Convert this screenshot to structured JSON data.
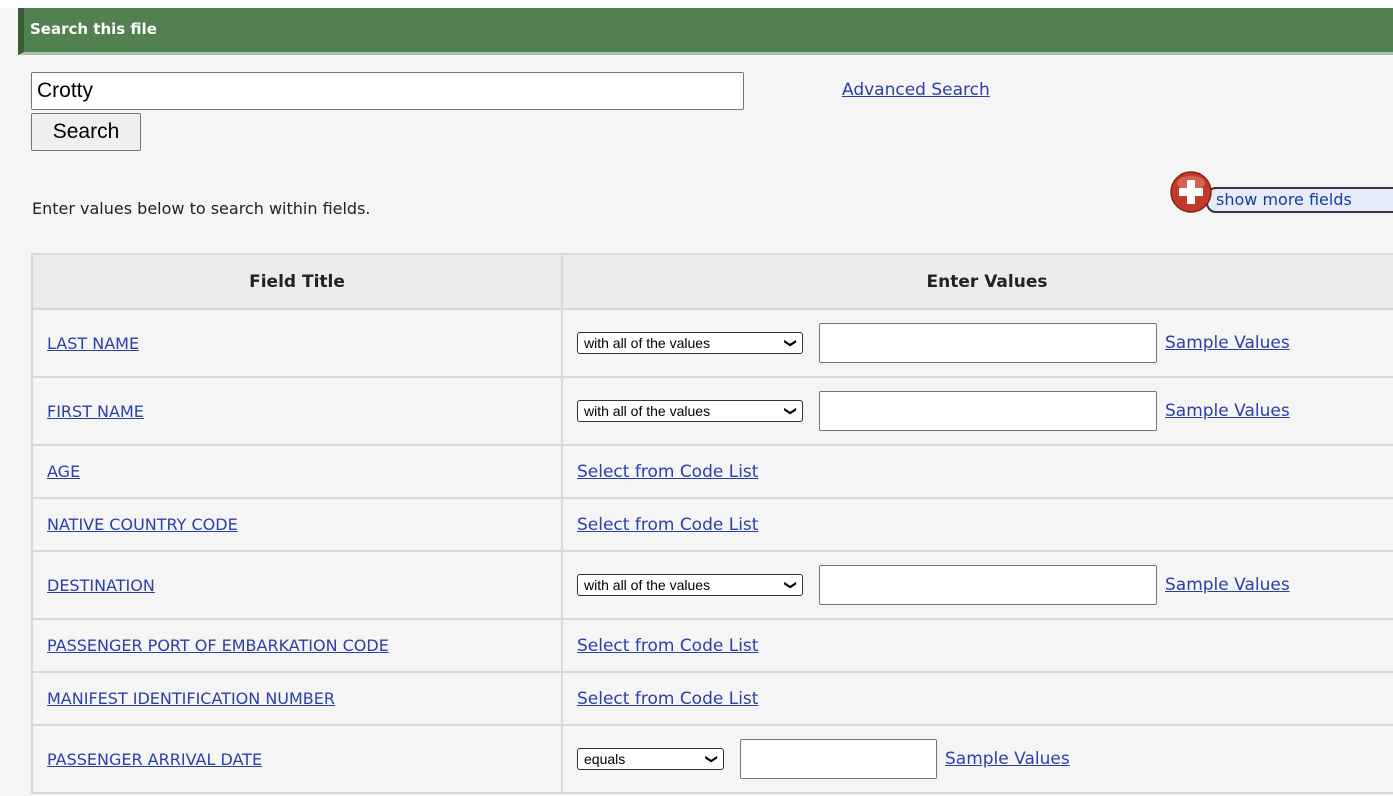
{
  "header": {
    "title": "Search this file"
  },
  "search": {
    "query_value": "Crotty",
    "button_label": "Search",
    "advanced_link": "Advanced Search"
  },
  "instructions": "Enter values below to search within fields.",
  "show_more": {
    "label": "show more fields"
  },
  "table": {
    "headers": [
      "Field Title",
      "Enter Values"
    ],
    "rows": [
      {
        "field": "LAST NAME",
        "type": "text",
        "operator": "with all of the values",
        "sample": "Sample Values"
      },
      {
        "field": "FIRST NAME",
        "type": "text",
        "operator": "with all of the values",
        "sample": "Sample Values"
      },
      {
        "field": "AGE",
        "type": "code",
        "code_link": "Select from Code List"
      },
      {
        "field": "NATIVE COUNTRY CODE",
        "type": "code",
        "code_link": "Select from Code List"
      },
      {
        "field": "DESTINATION",
        "type": "text",
        "operator": "with all of the values",
        "sample": "Sample Values"
      },
      {
        "field": "PASSENGER PORT OF EMBARKATION CODE",
        "type": "code",
        "code_link": "Select from Code List"
      },
      {
        "field": "MANIFEST IDENTIFICATION NUMBER",
        "type": "code",
        "code_link": "Select from Code List"
      },
      {
        "field": "PASSENGER ARRIVAL DATE",
        "type": "date",
        "operator": "equals",
        "sample": "Sample Values"
      }
    ]
  },
  "colors": {
    "header_green": "#538050",
    "link_blue": "#2c3fa8",
    "plus_red": "#c0392b"
  }
}
